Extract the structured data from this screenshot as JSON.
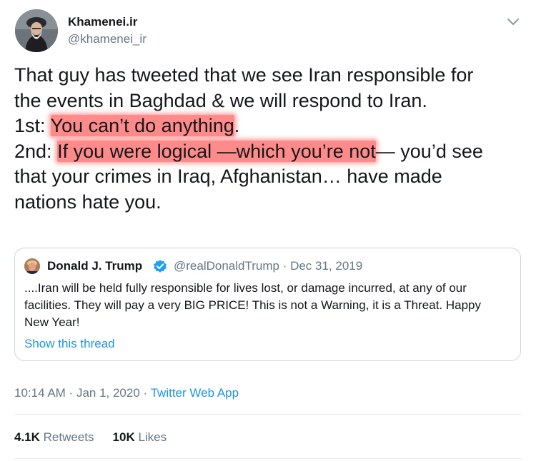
{
  "author": {
    "name": "Khamenei.ir",
    "handle": "@khamenei_ir"
  },
  "tweet": {
    "line1": "That guy has tweeted that we see Iran responsible for",
    "line2": "the events in Baghdad & we will respond to Iran.",
    "line3_prefix": "1st: ",
    "line3_highlight": "You can’t do anything",
    "line3_suffix": ".",
    "line4_prefix": "2nd: ",
    "line4_highlight": "If you were logical —which you’re not",
    "line4_suffix": "— you’d see",
    "line5": "that your crimes in Iraq, Afghanistan… have made",
    "line6": "nations hate you.",
    "highlight_color": "#ff8a8a"
  },
  "quoted": {
    "name": "Donald J. Trump",
    "verified_icon": "verified-badge-icon",
    "handle": "@realDonaldTrump",
    "separator": " · ",
    "date": "Dec 31, 2019",
    "text_line1": "....Iran will be held fully responsible for lives lost, or damage incurred, at any of our",
    "text_line2": "facilities. They will pay a very BIG PRICE! This is not a Warning, it is a Threat. Happy",
    "text_line3": "New Year!",
    "show_thread": "Show this thread"
  },
  "meta": {
    "time": "10:14 AM",
    "separator": " · ",
    "date": "Jan 1, 2020",
    "app": "Twitter Web App"
  },
  "stats": {
    "retweets_count": "4.1K",
    "retweets_label": "Retweets",
    "likes_count": "10K",
    "likes_label": "Likes"
  },
  "colors": {
    "link": "#1b95e0",
    "secondary": "#657786",
    "primary_text": "#14171a",
    "border": "#ccd6dd",
    "verified": "#1da1f2"
  }
}
